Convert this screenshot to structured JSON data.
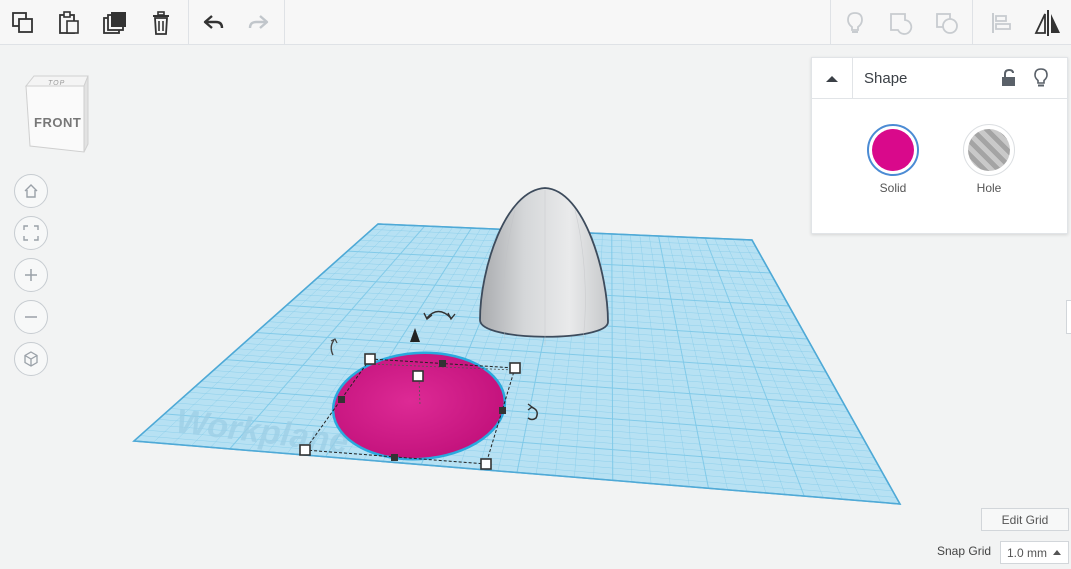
{
  "toolbar": {
    "left_tools": [
      "copy-icon",
      "paste-icon",
      "duplicate-icon",
      "delete-icon"
    ],
    "history_tools": [
      "undo-icon",
      "redo-icon"
    ],
    "right_tools": [
      "show-all-icon",
      "group-icon",
      "ungroup-icon",
      "align-icon",
      "mirror-icon"
    ]
  },
  "viewcube": {
    "top_label": "TOP",
    "front_label": "FRONT"
  },
  "nav": [
    "home-view-icon",
    "fit-all-icon",
    "zoom-in-icon",
    "zoom-out-icon",
    "perspective-icon"
  ],
  "workplane": {
    "label": "Workplane",
    "grid_color": "#7fc9e8"
  },
  "selected_shape": {
    "color": "#d81b8c",
    "outline": "#29a8dd"
  },
  "paraboloid": {
    "color": "#d3d4d6"
  },
  "shape_panel": {
    "title": "Shape",
    "solid_label": "Solid",
    "hole_label": "Hole",
    "solid_color": "#d9098b"
  },
  "edit_grid_label": "Edit Grid",
  "snap_grid": {
    "label": "Snap Grid",
    "value": "1.0 mm"
  },
  "colors": {
    "accent": "#4b8bd4",
    "toolbar_bg": "#f7f7f7"
  }
}
